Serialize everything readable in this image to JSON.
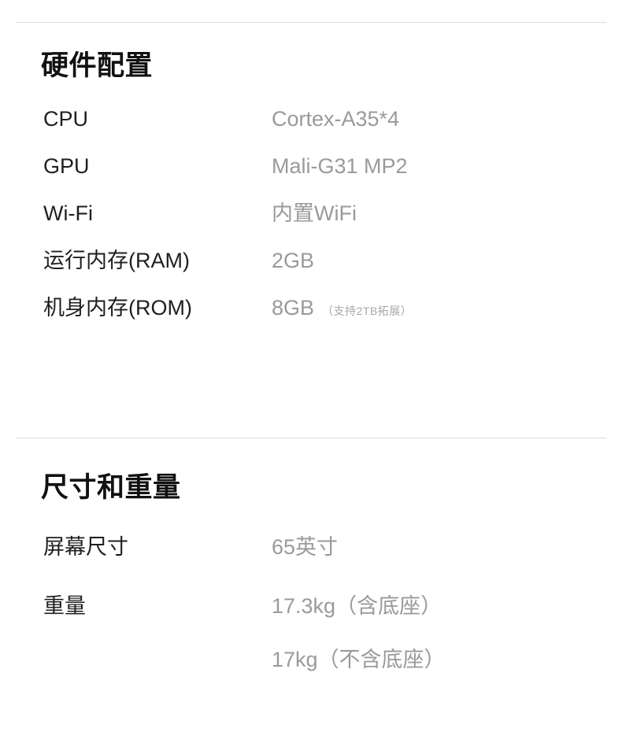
{
  "colors": {
    "background": "#ffffff",
    "label_text": "#1f1f1f",
    "value_text": "#9a9a9a",
    "note_text": "#a8a8a8",
    "divider": "#dcdcdc",
    "heading_text": "#111111"
  },
  "sections": [
    {
      "title": "硬件配置",
      "rows": [
        {
          "label": "CPU",
          "value": "Cortex-A35*4",
          "note": ""
        },
        {
          "label": "GPU",
          "value": "Mali-G31 MP2",
          "note": ""
        },
        {
          "label": "Wi-Fi",
          "value": "内置WiFi",
          "note": ""
        },
        {
          "label": "运行内存(RAM)",
          "value": "2GB",
          "note": ""
        },
        {
          "label": "机身内存(ROM)",
          "value": "8GB",
          "note": "（支持2TB拓展）"
        }
      ]
    },
    {
      "title": "尺寸和重量",
      "rows": [
        {
          "label": "屏幕尺寸",
          "value": "65英寸",
          "note": ""
        },
        {
          "label": "重量",
          "value_lines": [
            "17.3kg（含底座）",
            "17kg（不含底座）"
          ],
          "note": ""
        }
      ]
    }
  ]
}
